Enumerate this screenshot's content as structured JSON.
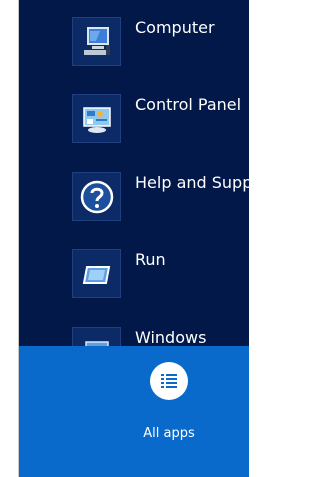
{
  "apps": [
    {
      "label": "Computer",
      "icon": "computer-icon"
    },
    {
      "label": "Control Panel",
      "icon": "control-panel-icon"
    },
    {
      "label": "Help and Supp",
      "icon": "help-icon"
    },
    {
      "label": "Run",
      "icon": "run-icon"
    },
    {
      "label": "Windows",
      "icon": "windows-icon"
    }
  ],
  "all_apps": {
    "label": "All apps",
    "icon": "all-apps-icon"
  },
  "colors": {
    "panel_background": "#011848",
    "tile_background": "#0b2a66",
    "all_apps_bar": "#0a6acb",
    "text": "#ffffff"
  }
}
